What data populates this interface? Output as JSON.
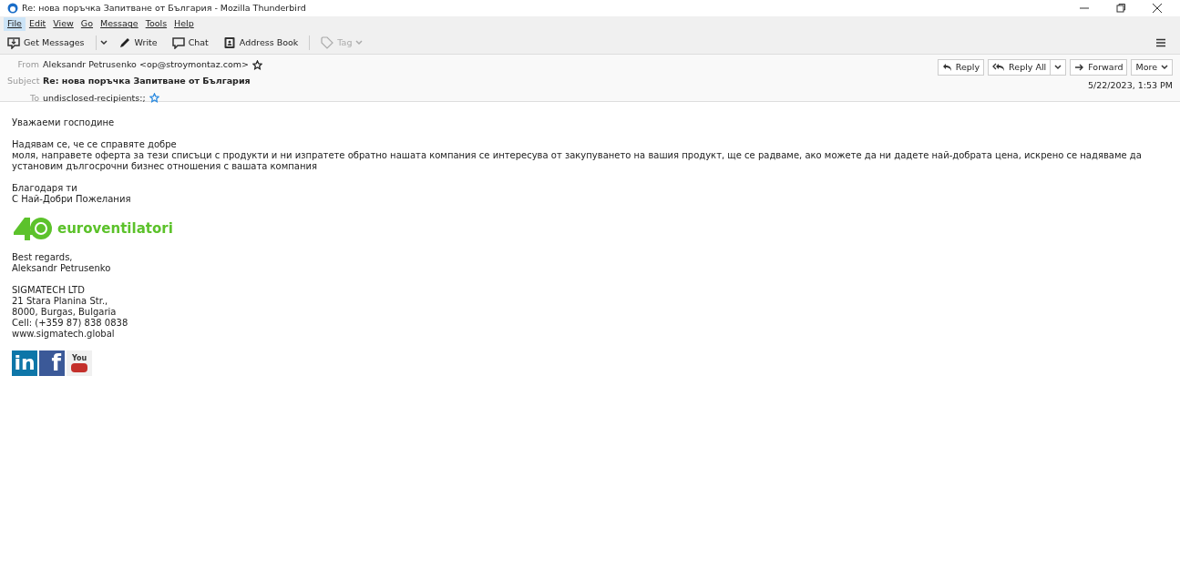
{
  "window": {
    "title": "Re: нова поръчка Запитване от България - Mozilla Thunderbird"
  },
  "menu": [
    {
      "label": "File",
      "selected": true
    },
    {
      "label": "Edit",
      "selected": false
    },
    {
      "label": "View",
      "selected": false
    },
    {
      "label": "Go",
      "selected": false
    },
    {
      "label": "Message",
      "selected": false
    },
    {
      "label": "Tools",
      "selected": false
    },
    {
      "label": "Help",
      "selected": false
    }
  ],
  "toolbar": [
    {
      "kind": "get",
      "label": "Get Messages",
      "disabled": false
    },
    {
      "kind": "write",
      "label": "Write",
      "disabled": false
    },
    {
      "kind": "chat",
      "label": "Chat",
      "disabled": false
    },
    {
      "kind": "book",
      "label": "Address Book",
      "disabled": false
    },
    {
      "kind": "tag",
      "label": "Tag",
      "disabled": true
    }
  ],
  "header": {
    "from_label": "From",
    "from": "Aleksandr Petrusenko <op@stroymontaz.com>",
    "subject_label": "Subject",
    "subject": "Re: нова поръчка Запитване от България",
    "to_label": "To",
    "to": "undisclosed-recipients:;",
    "date": "5/22/2023, 1:53 PM",
    "actions": [
      {
        "kind": "reply",
        "label": "Reply"
      },
      {
        "kind": "replyall",
        "label": "Reply All"
      },
      {
        "kind": "forward",
        "label": "Forward"
      },
      {
        "kind": "more",
        "label": "More"
      }
    ]
  },
  "body": {
    "paragraphs": [
      [
        "Уважаеми господине"
      ],
      [
        "Надявам се, че се справяте добре",
        "моля, направете оферта за тези списъци с продукти и ни изпратете обратно нашата компания се интересува от закупуването на вашия продукт, ще се радваме, ако можете да ни дадете най-добрата цена, искрено се надяваме да установим дългосрочни бизнес отношения с вашата компания"
      ],
      [
        "Благодаря ти",
        "С Най-Добри Пожелания"
      ]
    ],
    "logo_text": "euroventilatori",
    "signature": [
      [
        "Best regards,",
        "Aleksandr Petrusenko"
      ],
      [
        "SIGMATECH LTD",
        "21 Stara Planina Str.,",
        "8000, Burgas, Bulgaria",
        "Cell: (+359 87) 838 0838",
        "www.sigmatech.global"
      ]
    ],
    "social": [
      {
        "kind": "linkedin",
        "label": "in"
      },
      {
        "kind": "facebook",
        "label": "f"
      },
      {
        "kind": "youtube",
        "label": "You"
      }
    ]
  }
}
